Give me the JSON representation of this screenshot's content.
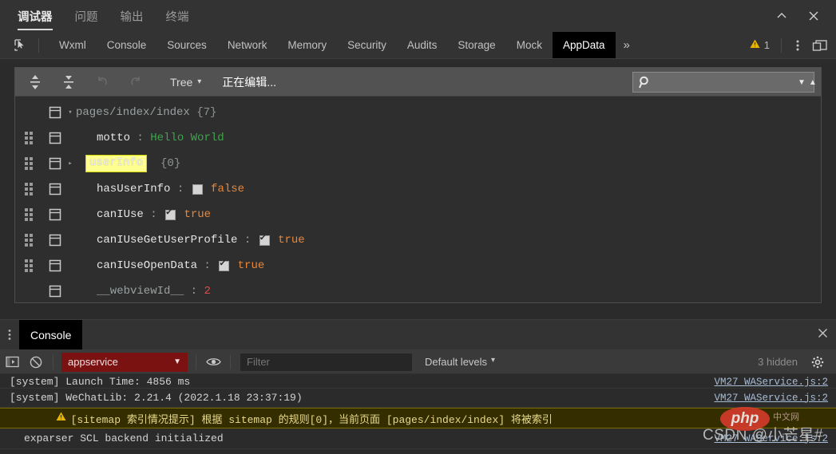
{
  "window": {
    "tabs": [
      {
        "label": "调试器",
        "active": true
      },
      {
        "label": "问题",
        "active": false
      },
      {
        "label": "输出",
        "active": false
      },
      {
        "label": "终端",
        "active": false
      }
    ],
    "collapse_icon": "chevron-up-icon",
    "close_icon": "close-icon"
  },
  "devtools": {
    "inspect_icon": "inspect-element-icon",
    "tabs": [
      {
        "label": "Wxml",
        "active": false
      },
      {
        "label": "Console",
        "active": false
      },
      {
        "label": "Sources",
        "active": false
      },
      {
        "label": "Network",
        "active": false
      },
      {
        "label": "Memory",
        "active": false
      },
      {
        "label": "Security",
        "active": false
      },
      {
        "label": "Audits",
        "active": false
      },
      {
        "label": "Storage",
        "active": false
      },
      {
        "label": "Mock",
        "active": false
      },
      {
        "label": "AppData",
        "active": true
      }
    ],
    "more_label": "»",
    "warning_count": "1",
    "warning_icon": "warning-triangle-icon",
    "kebab_icon": "more-vertical-icon",
    "dock_icon": "dock-panel-icon"
  },
  "appdata": {
    "toolbar": {
      "expand_all_icon": "expand-all-icon",
      "collapse_all_icon": "collapse-all-icon",
      "undo_icon": "undo-icon",
      "redo_icon": "redo-icon",
      "view_mode": "Tree",
      "view_mode_caret": "▾",
      "editing_status": "正在编辑...",
      "search_placeholder": "",
      "search_value": "",
      "search_icon": "search-icon",
      "search_prev_icon": "triangle-down-icon",
      "search_next_icon": "triangle-up-icon"
    },
    "root": {
      "path": "pages/index/index",
      "count": "{7}",
      "disclosure": "▾"
    },
    "rows": [
      {
        "key": "motto",
        "key_style": "name",
        "value": "Hello World",
        "value_style": "string",
        "has_handle": true,
        "disclosure": "",
        "editing": false,
        "checkbox": null
      },
      {
        "key": "userInfo",
        "key_style": "editing",
        "value": "{0}",
        "value_style": "count",
        "has_handle": true,
        "disclosure": "▸",
        "editing": true,
        "checkbox": null
      },
      {
        "key": "hasUserInfo",
        "key_style": "name",
        "value": "false",
        "value_style": "bool",
        "has_handle": true,
        "disclosure": "",
        "editing": false,
        "checkbox": false
      },
      {
        "key": "canIUse",
        "key_style": "name",
        "value": "true",
        "value_style": "bool",
        "has_handle": true,
        "disclosure": "",
        "editing": false,
        "checkbox": true
      },
      {
        "key": "canIUseGetUserProfile",
        "key_style": "name",
        "value": "true",
        "value_style": "bool",
        "has_handle": true,
        "disclosure": "",
        "editing": false,
        "checkbox": true
      },
      {
        "key": "canIUseOpenData",
        "key_style": "name",
        "value": "true",
        "value_style": "bool",
        "has_handle": true,
        "disclosure": "",
        "editing": false,
        "checkbox": true
      },
      {
        "key": "__webviewId__",
        "key_style": "name",
        "value": "2",
        "value_style": "number",
        "has_handle": false,
        "disclosure": "",
        "editing": false,
        "checkbox": null
      }
    ]
  },
  "console": {
    "kebab_icon": "more-vertical-icon",
    "tab_label": "Console",
    "close_icon": "close-icon",
    "sidebar_icon": "console-sidebar-icon",
    "clear_icon": "clear-console-icon",
    "context": "appservice",
    "context_caret": "▼",
    "eye_icon": "eye-icon",
    "filter_placeholder": "Filter",
    "filter_value": "",
    "levels_label": "Default levels",
    "levels_caret": "▾",
    "hidden_label": "3 hidden",
    "settings_icon": "gear-icon",
    "messages": [
      {
        "text": "[system] Launch Time: 4856 ms",
        "level": "info",
        "source": "VM27 WAService.js:2",
        "clipped_top": true
      },
      {
        "text": "[system] WeChatLib: 2.21.4 (2022.1.18 23:37:19)",
        "level": "info",
        "source": "VM27 WAService.js:2",
        "clipped_top": false
      },
      {
        "text": "[sitemap 索引情况提示] 根据 sitemap 的规则[0]，当前页面 [pages/index/index] 将被索引",
        "level": "warning",
        "source": "",
        "clipped_top": false
      },
      {
        "text": "exparser SCL backend initialized",
        "level": "info",
        "source": "VM27 WAService.js:2",
        "clipped_top": false
      }
    ]
  },
  "watermark": {
    "badge": "php",
    "badge_sub": "中文网",
    "text": "CSDN @小芒星#"
  },
  "colors": {
    "accent_string": "#3fa34d",
    "accent_bool": "#e8873a",
    "accent_number": "#e04c4c",
    "warning": "#e8b400",
    "context_bg": "#7a1212",
    "edit_highlight": "#ffff90"
  }
}
